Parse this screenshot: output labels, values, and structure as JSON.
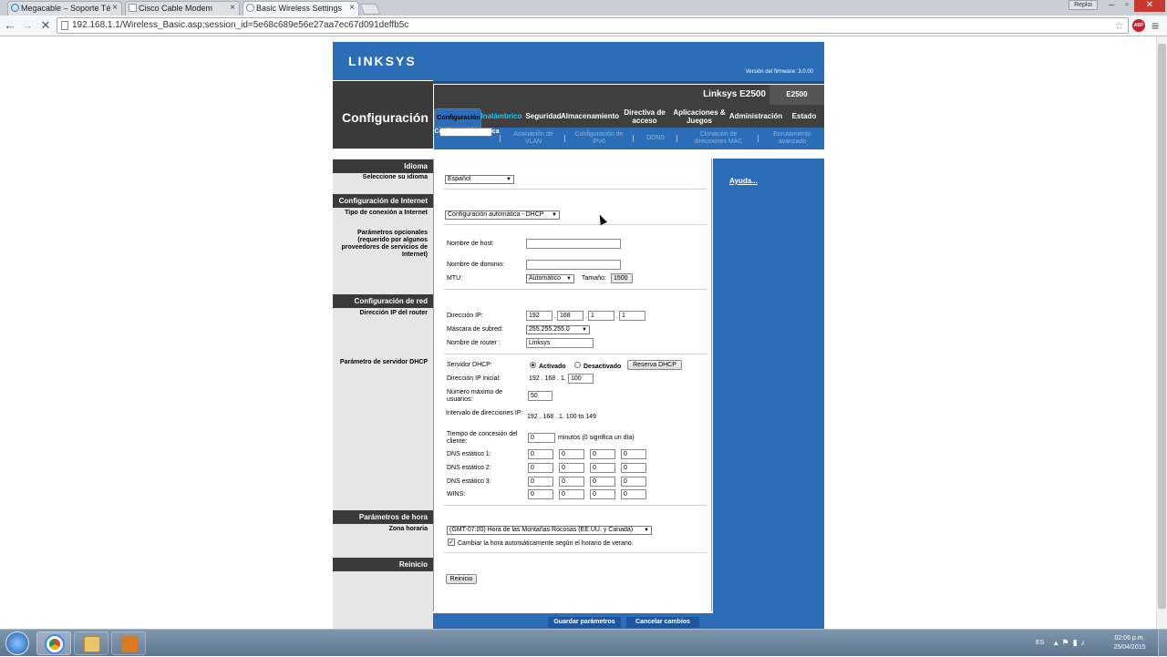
{
  "browser": {
    "tabs": [
      {
        "title": "Megacable – Soporte Té"
      },
      {
        "title": "Cisco Cable Modem"
      },
      {
        "title": "Basic Wireless Settings"
      }
    ],
    "user_button": "Reploi",
    "url": "192.168.1.1/Wireless_Basic.asp;session_id=5e68c689e56e27aa7ec67d091deffb5c",
    "abp_label": "ABP"
  },
  "router": {
    "logo": "LINKSYS",
    "firmware": "Versión del firmware: 3.0.00",
    "section_title": "Configuración",
    "model_name": "Linksys E2500",
    "model_box": "E2500",
    "main_tabs": [
      {
        "label": "Configuración"
      },
      {
        "label": "Inalámbrico"
      },
      {
        "label": "Seguridad"
      },
      {
        "label": "Almacenamiento"
      },
      {
        "label": "Directiva de acceso"
      },
      {
        "label": "Aplicaciones & Juegos"
      },
      {
        "label": "Administración"
      },
      {
        "label": "Estado"
      }
    ],
    "sub_tabs": [
      {
        "label": "Configuración básica"
      },
      {
        "label": "Asociación de VLAN"
      },
      {
        "label": "Configuración de IPv6"
      },
      {
        "label": "DDNS"
      },
      {
        "label": "Clonación de direcciones MAC"
      },
      {
        "label": "Enrutamiento avanzado"
      }
    ],
    "left": {
      "idioma": "Idioma",
      "seleccione": "Seleccione su idioma",
      "config_internet": "Configuración de Internet",
      "tipo_conexion": "Tipo de conexión a Internet",
      "parametros_opcionales": "Parámetros opcionales (requerido por algunos proveedores de servicios de Internet)",
      "config_red": "Configuración de red",
      "direccion_ip_router": "Dirección IP del router",
      "param_dhcp": "Parámetro de servidor DHCP",
      "param_hora": "Parámetros de hora",
      "zona_horaria": "Zona horaria",
      "reinicio": "Reinicio"
    },
    "form": {
      "idioma_value": "Español",
      "conexion_value": "Configuración automática - DHCP",
      "host_label": "Nombre de host:",
      "host_value": "",
      "dominio_label": "Nombre de dominio:",
      "dominio_value": "",
      "mtu_label": "MTU:",
      "mtu_value": "Automático",
      "tamano_label": "Tamaño:",
      "tamano_value": "1500",
      "ip_label": "Dirección IP:",
      "ip": [
        "192",
        "168",
        "1",
        "1"
      ],
      "mascara_label": "Máscara de subred:",
      "mascara_value": "255.255.255.0",
      "router_name_label": "Nombre de router :",
      "router_name_value": "Linksys",
      "dhcp_label": "Servidor DHCP:",
      "activado": "Activado",
      "desactivado": "Desactivado",
      "reserva_btn": "Reserva DHCP",
      "ip_inicial_label": "Dirección IP inicial:",
      "ip_inicial_prefix": "192 . 168 . 1.",
      "ip_inicial_value": "100",
      "max_usuarios_label": "Número máximo de usuarios:",
      "max_usuarios_value": "50",
      "intervalo_label": "Intervalo de direcciones IP:",
      "intervalo_value": "192 . 168 . 1. 100 to 149",
      "concesion_label": "Tiempo de concesión del cliente:",
      "concesion_value": "0",
      "concesion_suffix": "minutos (0 significa un día)",
      "dns1_label": "DNS estático 1:",
      "dns2_label": "DNS estático 2:",
      "dns3_label": "DNS estático 3:",
      "wins_label": "WINS:",
      "zero": "0",
      "zona_value": "(GMT-07:00) Hora de las Montañas Rocosas (EE.UU. y Canadá)",
      "verano_label": "Cambiar la hora automáticamente según el horario de verano.",
      "reinicio_btn": "Reinicio"
    },
    "help": "Ayuda...",
    "save_btn": "Guardar parámetros",
    "cancel_btn": "Cancelar cambios"
  },
  "taskbar": {
    "lang": "ES",
    "time": "02:06 p.m.",
    "date": "25/04/2015"
  }
}
